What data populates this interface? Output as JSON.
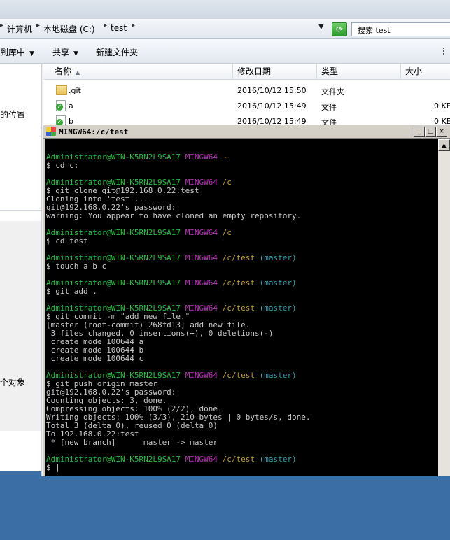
{
  "explorer": {
    "breadcrumb": [
      "计算机",
      "本地磁盘 (C:)",
      "test"
    ],
    "breadcrumb_lead": "▸",
    "search_placeholder": "搜索 test",
    "toolbar": [
      "到库中",
      "共享",
      "新建文件夹"
    ],
    "nav": {
      "location_text": "的位置",
      "object_text": "个对象"
    },
    "columns": [
      "名称",
      "修改日期",
      "类型",
      "大小"
    ],
    "files": [
      {
        "name": ".git",
        "date": "2016/10/12 15:50",
        "type": "文件夹",
        "size": "",
        "icon": "folder-icon"
      },
      {
        "name": "a",
        "date": "2016/10/12 15:49",
        "type": "文件",
        "size": "0 KE",
        "icon": "file-icon"
      },
      {
        "name": "b",
        "date": "2016/10/12 15:49",
        "type": "文件",
        "size": "0 KE",
        "icon": "file-icon"
      }
    ]
  },
  "terminal": {
    "title": "MINGW64:/c/test",
    "buttons": [
      "_",
      "□",
      "×"
    ],
    "lines": [
      [],
      [
        [
          "g",
          "Administrator@WIN-K5RN2L9SA17 "
        ],
        [
          "m",
          "MINGW64 "
        ],
        [
          "y",
          "~"
        ]
      ],
      [
        [
          "w",
          "$ cd c:"
        ]
      ],
      [],
      [
        [
          "g",
          "Administrator@WIN-K5RN2L9SA17 "
        ],
        [
          "m",
          "MINGW64 "
        ],
        [
          "y",
          "/c"
        ]
      ],
      [
        [
          "w",
          "$ git clone git@192.168.0.22:test"
        ]
      ],
      [
        [
          "w",
          "Cloning into 'test'..."
        ]
      ],
      [
        [
          "w",
          "git@192.168.0.22's password:"
        ]
      ],
      [
        [
          "w",
          "warning: You appear to have cloned an empty repository."
        ]
      ],
      [],
      [
        [
          "g",
          "Administrator@WIN-K5RN2L9SA17 "
        ],
        [
          "m",
          "MINGW64 "
        ],
        [
          "y",
          "/c"
        ]
      ],
      [
        [
          "w",
          "$ cd test"
        ]
      ],
      [],
      [
        [
          "g",
          "Administrator@WIN-K5RN2L9SA17 "
        ],
        [
          "m",
          "MINGW64 "
        ],
        [
          "y",
          "/c/test "
        ],
        [
          "c",
          "(master)"
        ]
      ],
      [
        [
          "w",
          "$ touch a b c"
        ]
      ],
      [],
      [
        [
          "g",
          "Administrator@WIN-K5RN2L9SA17 "
        ],
        [
          "m",
          "MINGW64 "
        ],
        [
          "y",
          "/c/test "
        ],
        [
          "c",
          "(master)"
        ]
      ],
      [
        [
          "w",
          "$ git add ."
        ]
      ],
      [],
      [
        [
          "g",
          "Administrator@WIN-K5RN2L9SA17 "
        ],
        [
          "m",
          "MINGW64 "
        ],
        [
          "y",
          "/c/test "
        ],
        [
          "c",
          "(master)"
        ]
      ],
      [
        [
          "w",
          "$ git commit -m \"add new file.\""
        ]
      ],
      [
        [
          "w",
          "[master (root-commit) 268fd13] add new file."
        ]
      ],
      [
        [
          "w",
          " 3 files changed, 0 insertions(+), 0 deletions(-)"
        ]
      ],
      [
        [
          "w",
          " create mode 100644 a"
        ]
      ],
      [
        [
          "w",
          " create mode 100644 b"
        ]
      ],
      [
        [
          "w",
          " create mode 100644 c"
        ]
      ],
      [],
      [
        [
          "g",
          "Administrator@WIN-K5RN2L9SA17 "
        ],
        [
          "m",
          "MINGW64 "
        ],
        [
          "y",
          "/c/test "
        ],
        [
          "c",
          "(master)"
        ]
      ],
      [
        [
          "w",
          "$ git push origin master"
        ]
      ],
      [
        [
          "w",
          "git@192.168.0.22's password:"
        ]
      ],
      [
        [
          "w",
          "Counting objects: 3, done."
        ]
      ],
      [
        [
          "w",
          "Compressing objects: 100% (2/2), done."
        ]
      ],
      [
        [
          "w",
          "Writing objects: 100% (3/3), 210 bytes | 0 bytes/s, done."
        ]
      ],
      [
        [
          "w",
          "Total 3 (delta 0), reused 0 (delta 0)"
        ]
      ],
      [
        [
          "w",
          "To 192.168.0.22:test"
        ]
      ],
      [
        [
          "w",
          " * [new branch]      master -> master"
        ]
      ],
      [],
      [
        [
          "g",
          "Administrator@WIN-K5RN2L9SA17 "
        ],
        [
          "m",
          "MINGW64 "
        ],
        [
          "y",
          "/c/test "
        ],
        [
          "c",
          "(master)"
        ]
      ],
      [
        [
          "w",
          "$ |"
        ]
      ]
    ]
  }
}
